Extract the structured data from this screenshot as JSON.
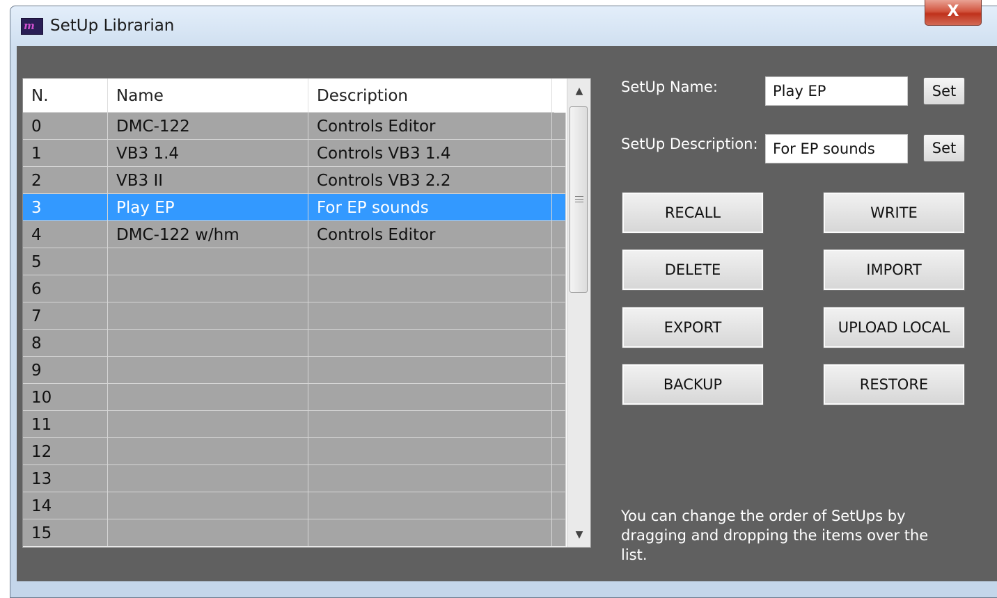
{
  "window": {
    "title": "SetUp Librarian",
    "icon": "app-logo-icon",
    "close_glyph": "X"
  },
  "table": {
    "headers": [
      "N.",
      "Name",
      "Description"
    ],
    "rows": [
      {
        "n": "0",
        "name": "DMC-122",
        "desc": "Controls Editor"
      },
      {
        "n": "1",
        "name": "VB3 1.4",
        "desc": "Controls VB3 1.4"
      },
      {
        "n": "2",
        "name": "VB3 II",
        "desc": "Controls VB3 2.2"
      },
      {
        "n": "3",
        "name": "Play EP",
        "desc": "For EP sounds",
        "selected": true
      },
      {
        "n": "4",
        "name": "DMC-122 w/hm",
        "desc": "Controls Editor"
      },
      {
        "n": "5",
        "name": "",
        "desc": ""
      },
      {
        "n": "6",
        "name": "",
        "desc": ""
      },
      {
        "n": "7",
        "name": "",
        "desc": ""
      },
      {
        "n": "8",
        "name": "",
        "desc": ""
      },
      {
        "n": "9",
        "name": "",
        "desc": ""
      },
      {
        "n": "10",
        "name": "",
        "desc": ""
      },
      {
        "n": "11",
        "name": "",
        "desc": ""
      },
      {
        "n": "12",
        "name": "",
        "desc": ""
      },
      {
        "n": "13",
        "name": "",
        "desc": ""
      },
      {
        "n": "14",
        "name": "",
        "desc": ""
      },
      {
        "n": "15",
        "name": "",
        "desc": ""
      }
    ],
    "scroll_up_glyph": "▲",
    "scroll_down_glyph": "▼"
  },
  "form": {
    "name_label": "SetUp Name:",
    "name_value": "Play EP",
    "desc_label": "SetUp Description:",
    "desc_value": "For EP sounds",
    "set_label": "Set"
  },
  "buttons": {
    "recall": "RECALL",
    "write": "WRITE",
    "delete": "DELETE",
    "import": "IMPORT",
    "export": "EXPORT",
    "upload_local": "UPLOAD LOCAL",
    "backup": "BACKUP",
    "restore": "RESTORE"
  },
  "hint": {
    "line1": "You can change the order of SetUps by",
    "line2": "dragging and dropping the items over the list."
  },
  "colors": {
    "panel": "#606060",
    "row": "#a5a5a5",
    "selection": "#3399ff"
  }
}
